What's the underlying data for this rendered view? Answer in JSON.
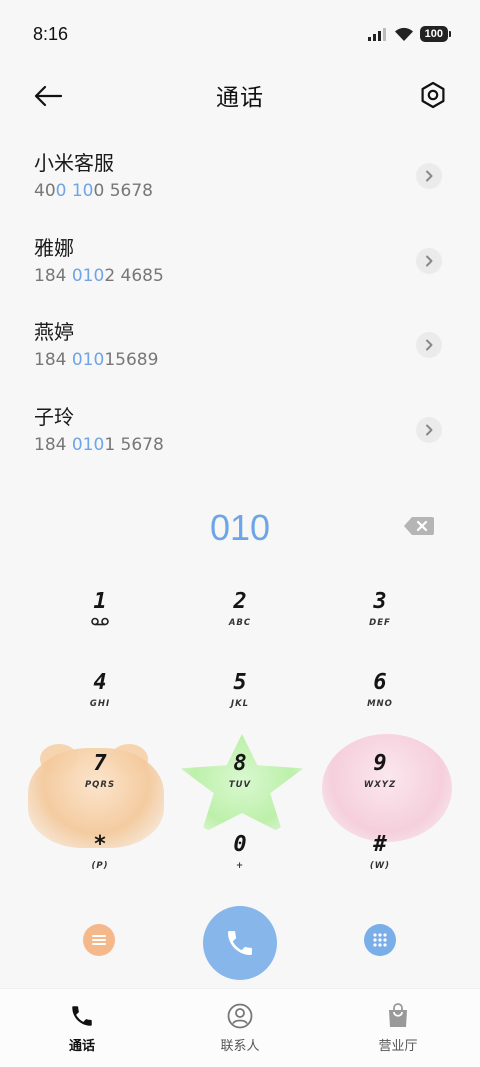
{
  "status_bar": {
    "time": "8:16",
    "battery": "100"
  },
  "header": {
    "title": "通话"
  },
  "contacts": [
    {
      "name": "小米客服",
      "number_parts": [
        "40",
        "0 10",
        "0 5678"
      ]
    },
    {
      "name": "雅娜",
      "number_parts": [
        "184 ",
        "010",
        "2 4685"
      ]
    },
    {
      "name": "燕婷",
      "number_parts": [
        "184 ",
        "010",
        "15689"
      ]
    },
    {
      "name": "子玲",
      "number_parts": [
        "184 ",
        "010",
        "1 5678"
      ]
    }
  ],
  "dialer": {
    "input": "010"
  },
  "keypad": [
    {
      "digit": "1",
      "letters": ""
    },
    {
      "digit": "2",
      "letters": "ABC"
    },
    {
      "digit": "3",
      "letters": "DEF"
    },
    {
      "digit": "4",
      "letters": "GHI"
    },
    {
      "digit": "5",
      "letters": "JKL"
    },
    {
      "digit": "6",
      "letters": "MNO"
    },
    {
      "digit": "7",
      "letters": "PQRS"
    },
    {
      "digit": "8",
      "letters": "TUV"
    },
    {
      "digit": "9",
      "letters": "WXYZ"
    },
    {
      "digit": "*",
      "letters": "(P)"
    },
    {
      "digit": "0",
      "letters": "+"
    },
    {
      "digit": "#",
      "letters": "(W)"
    }
  ],
  "bottom_nav": [
    {
      "label": "通话",
      "icon": "phone-icon",
      "active": true
    },
    {
      "label": "联系人",
      "icon": "person-icon",
      "active": false
    },
    {
      "label": "营业厅",
      "icon": "bag-icon",
      "active": false
    }
  ],
  "colors": {
    "accent": "#6ea5e6",
    "call_button": "#87b6ea",
    "menu_button": "#f5b88a"
  }
}
